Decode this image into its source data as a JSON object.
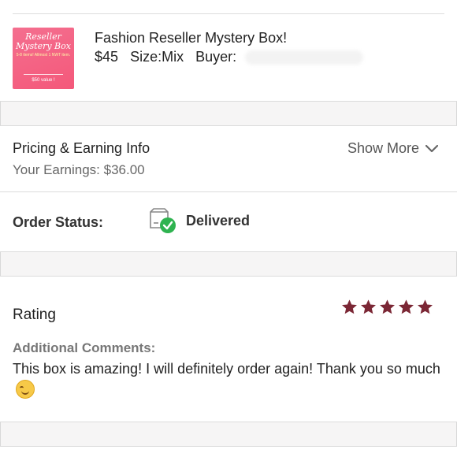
{
  "order": {
    "thumbnail": {
      "line1": "Reseller",
      "line2": "Mystery Box",
      "small_text": "5-8 items! Allmost 1 NWT item.",
      "value_text": "$50 value !"
    },
    "title": "Fashion Reseller Mystery Box!",
    "price": "$45",
    "size": "Size:Mix",
    "buyer_label": "Buyer:"
  },
  "pricing": {
    "heading": "Pricing & Earning Info",
    "earnings": "Your Earnings: $36.00",
    "show_more": "Show More"
  },
  "status": {
    "label": "Order Status:",
    "value": "Delivered",
    "icon": "delivered-box-icon"
  },
  "rating": {
    "title": "Rating",
    "stars": 5,
    "star_color": "#7b2735",
    "comments_label": "Additional Comments:",
    "comment": "This box is amazing! I will definitely order again! Thank you so much"
  },
  "colors": {
    "accent": "#7b2735",
    "check_green": "#2fb350"
  }
}
